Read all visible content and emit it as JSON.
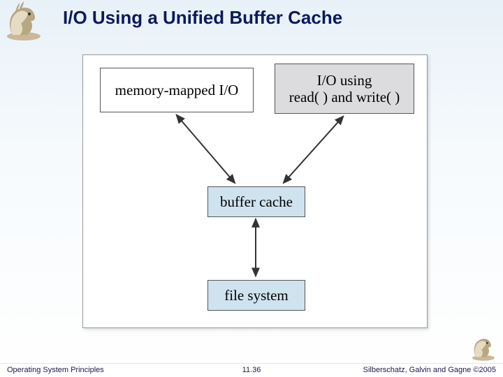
{
  "title": "I/O Using a Unified Buffer Cache",
  "boxes": {
    "memory_mapped": "memory-mapped I/O",
    "read_write_l1": "I/O using",
    "read_write_l2": "read( ) and write( )",
    "buffer_cache": "buffer cache",
    "file_system": "file system"
  },
  "footer": {
    "left": "Operating System Principles",
    "center": "11.36",
    "right": "Silberschatz, Galvin and Gagne ©2005"
  },
  "icons": {
    "logo_tl": "dinosaur-mascot",
    "logo_br": "dinosaur-mascot-small"
  },
  "colors": {
    "title": "#0b1a5c",
    "box_light": "#cfe3ef",
    "box_gray": "#dcdcde"
  }
}
